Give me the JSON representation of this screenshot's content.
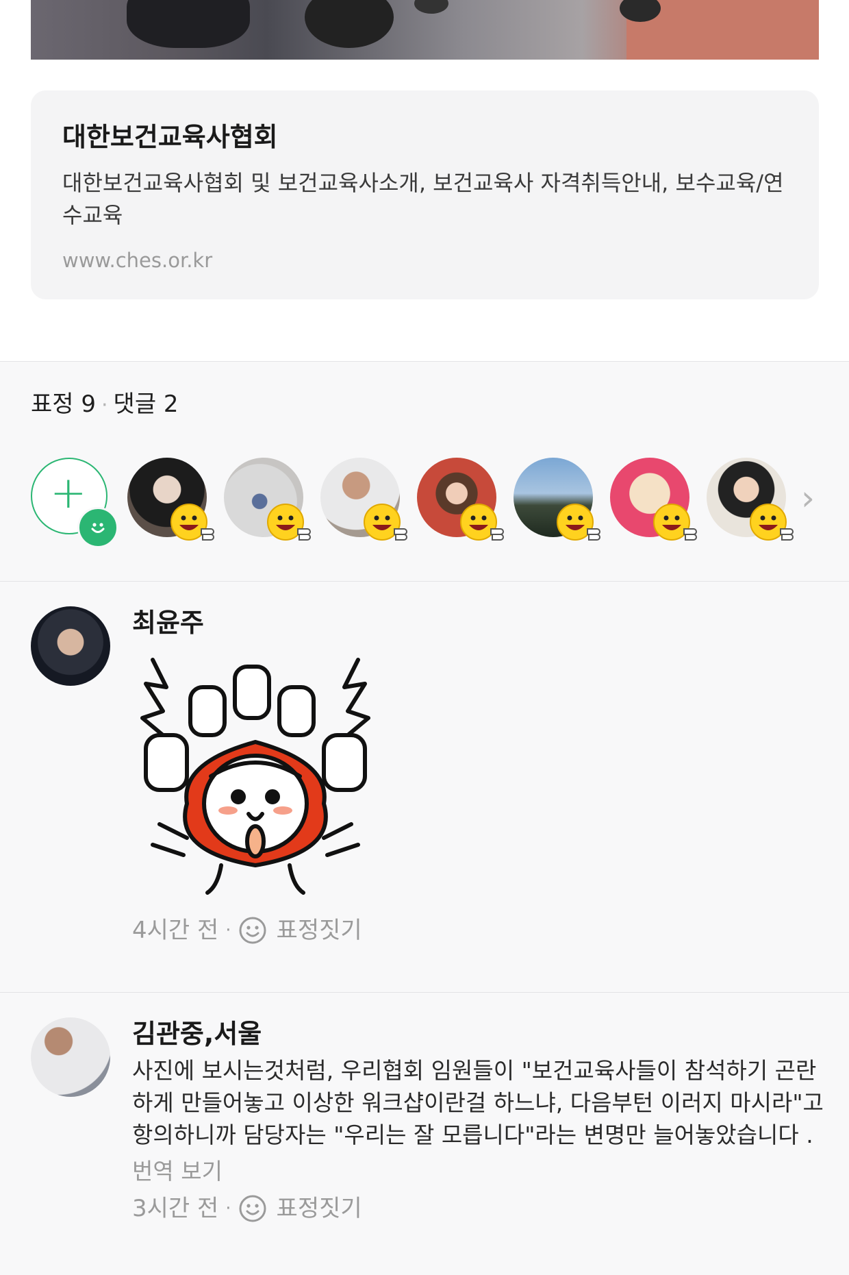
{
  "link_card": {
    "title": "대한보건교육사협회",
    "description": "대한보건교육사협회 및 보건교육사소개, 보건교육사 자격취득안내, 보수교육/연수교육",
    "url": "www.ches.or.kr"
  },
  "counts": {
    "reactions_label": "표정 9",
    "separator": "·",
    "comments_label": "댓글 2"
  },
  "reaction_row": {
    "add_icon": "add-reaction-icon",
    "reactor_count_shown": 7,
    "reaction_icon": "thumbs-up-smile-icon",
    "more_icon": "chevron-right-icon",
    "accent_color": "#2bb673"
  },
  "comments": [
    {
      "author": "최윤주",
      "content_type": "sticker",
      "sticker": "thumbs-up-character-sticker",
      "time": "4시간 전",
      "react_label": "표정짓기"
    },
    {
      "author": "김관중,서울",
      "text": "사진에 보시는것처럼, 우리협회 임원들이 \"보건교육사들이 참석하기 곤란하게 만들어놓고 이상한 워크샵이란걸 하느냐, 다음부턴 이러지 마시라\"고 항의하니까  담당자는 \"우리는 잘 모릅니다\"라는 변명만 늘어놓았습니다 .",
      "translate": "번역 보기",
      "time": "3시간 전",
      "react_label": "표정짓기"
    }
  ]
}
